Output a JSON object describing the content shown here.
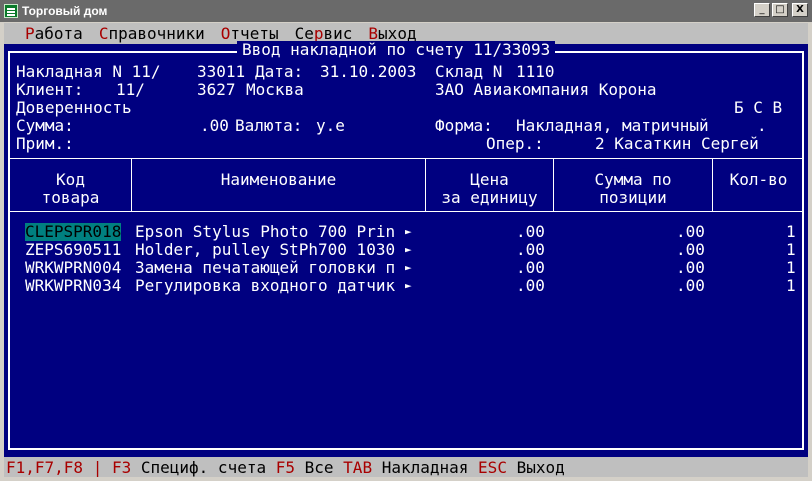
{
  "window": {
    "title": "Торговый дом",
    "minimize": "_",
    "maximize": "□",
    "close": "X"
  },
  "menu": [
    {
      "hot": "Р",
      "rest": "абота"
    },
    {
      "hot": "С",
      "rest": "правочники"
    },
    {
      "hot": "О",
      "rest": "тчеты"
    },
    {
      "pre": "Се",
      "hot": "р",
      "rest": "вис"
    },
    {
      "hot": "В",
      "rest": "ыход"
    }
  ],
  "form": {
    "title": "Ввод накладной по счету 11/33093",
    "invoice_label": "Накладная N 11/",
    "invoice_number": "33011",
    "date_label": "Дата:",
    "date": "31.10.2003",
    "warehouse_label": "Склад N",
    "warehouse_number": "1110",
    "client_label": "Клиент:",
    "client_prefix": "11/",
    "client_code": "3627",
    "client_city": "Москва",
    "client_name": "ЗАО Авиакомпания Корона",
    "power_of_attorney_label": "Доверенность",
    "flags": "Б С В",
    "sum_label": "Сумма:",
    "sum": ".00",
    "currency_label": "Валюта:",
    "currency": "у.е",
    "form_label": "Форма:",
    "form_value": "Накладная, матричный",
    "form_dot": ".",
    "note_label": "Прим.:",
    "operator_label": "Опер.:",
    "operator": "2 Касаткин Сергей"
  },
  "table": {
    "headers": {
      "code_1": "Код",
      "code_2": "товара",
      "name": "Наименование",
      "price_1": "Цена",
      "price_2": "за единицу",
      "sum_1": "Сумма по",
      "sum_2": "позиции",
      "qty": "Кол-во"
    },
    "rows": [
      {
        "code": "CLEPSPR018",
        "name": "Epson Stylus Photo 700 Prin",
        "price": ".00",
        "sum": ".00",
        "qty": "1",
        "selected": true
      },
      {
        "code": "ZEPS690511",
        "name": "Holder, pulley StPh700 1030",
        "price": ".00",
        "sum": ".00",
        "qty": "1"
      },
      {
        "code": "WRKWPRN004",
        "name": "Замена печатающей головки п",
        "price": ".00",
        "sum": ".00",
        "qty": "1"
      },
      {
        "code": "WRKWPRN034",
        "name": "Регулировка входного датчик",
        "price": ".00",
        "sum": ".00",
        "qty": "1"
      }
    ],
    "more_indicator": "►"
  },
  "status": {
    "k1": "F1,F7,F8 | F3",
    "t1": " Специф. счета ",
    "k2": "F5",
    "t2": " Все ",
    "k3": "TAB",
    "t3": " Накладная ",
    "k4": "ESC",
    "t4": " Выход"
  }
}
